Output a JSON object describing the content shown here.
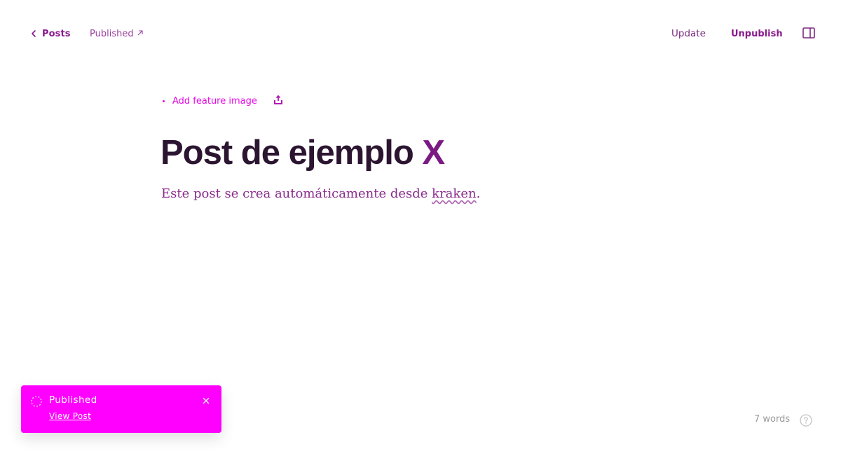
{
  "header": {
    "back_label": "Posts",
    "status_label": "Published",
    "update_label": "Update",
    "unpublish_label": "Unpublish"
  },
  "editor": {
    "feature_image_label": "Add feature image",
    "title_main": "Post de ejemplo ",
    "title_tail": "X",
    "body_before": "Este post se crea automáticamente desde ",
    "body_misspelled": "kraken",
    "body_after": "."
  },
  "toast": {
    "title": "Published",
    "link_label": "View Post"
  },
  "footer": {
    "word_count": "7 words"
  },
  "icons": {
    "back": "chevron-left-icon",
    "external": "external-link-icon",
    "sidebar": "sidebar-panel-icon",
    "upload": "upload-icon",
    "spinner": "loading-spinner-icon",
    "close": "close-icon",
    "help": "help-circle-icon"
  },
  "colors": {
    "accent": "#ff00ff",
    "title": "#2b1530",
    "body": "#8a2a8e",
    "muted": "#9a9a9a"
  }
}
